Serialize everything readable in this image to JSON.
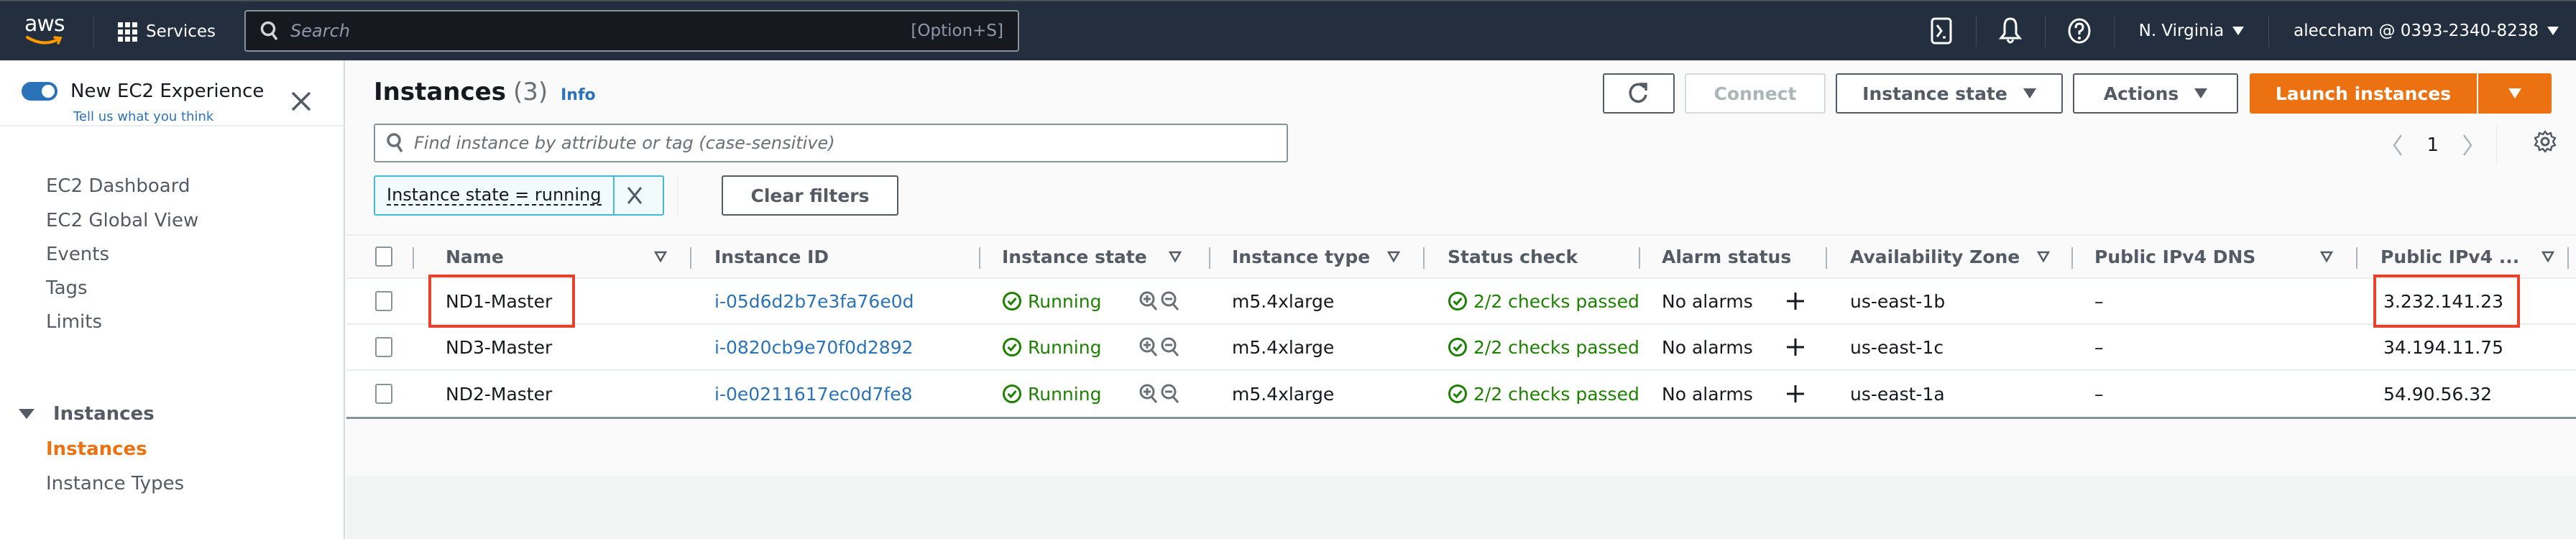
{
  "topnav": {
    "logo_text": "aws",
    "services_label": "Services",
    "search_placeholder": "Search",
    "search_shortcut": "[Option+S]",
    "region": "N. Virginia",
    "account": "aleccham @ 0393-2340-8238"
  },
  "sidebar": {
    "experience_title": "New EC2 Experience",
    "experience_link": "Tell us what you think",
    "experience_enabled": true,
    "items": [
      {
        "label": "EC2 Dashboard"
      },
      {
        "label": "EC2 Global View"
      },
      {
        "label": "Events"
      },
      {
        "label": "Tags"
      },
      {
        "label": "Limits"
      }
    ],
    "section": {
      "label": "Instances",
      "items": [
        {
          "label": "Instances",
          "active": true
        },
        {
          "label": "Instance Types"
        }
      ]
    }
  },
  "main": {
    "title": "Instances",
    "count": "(3)",
    "info_label": "Info",
    "buttons": {
      "connect": "Connect",
      "instance_state": "Instance state",
      "actions": "Actions",
      "launch": "Launch instances"
    },
    "filter_placeholder": "Find instance by attribute or tag (case-sensitive)",
    "active_filter": "Instance state = running",
    "clear_filters": "Clear filters",
    "page": "1"
  },
  "table": {
    "columns": [
      "Name",
      "Instance ID",
      "Instance state",
      "Instance type",
      "Status check",
      "Alarm status",
      "Availability Zone",
      "Public IPv4 DNS",
      "Public IPv4 ..."
    ],
    "rows": [
      {
        "name": "ND1-Master",
        "id": "i-05d6d2b7e3fa76e0d",
        "state": "Running",
        "type": "m5.4xlarge",
        "status": "2/2 checks passed",
        "alarm": "No alarms",
        "az": "us-east-1b",
        "dns": "–",
        "ip": "3.232.141.23",
        "highlighted": true
      },
      {
        "name": "ND3-Master",
        "id": "i-0820cb9e70f0d2892",
        "state": "Running",
        "type": "m5.4xlarge",
        "status": "2/2 checks passed",
        "alarm": "No alarms",
        "az": "us-east-1c",
        "dns": "–",
        "ip": "34.194.11.75"
      },
      {
        "name": "ND2-Master",
        "id": "i-0e0211617ec0d7fe8",
        "state": "Running",
        "type": "m5.4xlarge",
        "status": "2/2 checks passed",
        "alarm": "No alarms",
        "az": "us-east-1a",
        "dns": "–",
        "ip": "54.90.56.32"
      }
    ]
  },
  "colors": {
    "nav_bg": "#232f3e",
    "accent_orange": "#ec7211",
    "link_blue": "#2a73b8",
    "success_green": "#1d8102",
    "highlight_red": "#e8412c"
  }
}
